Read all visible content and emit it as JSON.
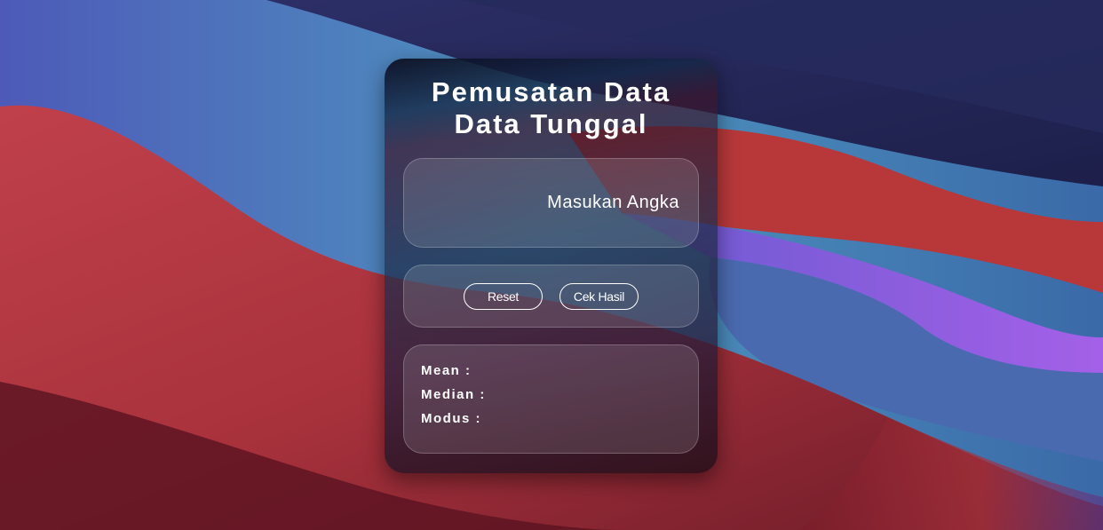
{
  "colors": {
    "wallpaper_red": "#b83a3a",
    "wallpaper_purple": "#9b5bd8",
    "wallpaper_navy": "#242755",
    "wallpaper_blue": "#4f8fc0",
    "text": "#ffffff"
  },
  "card": {
    "title_line1": "Pemusatan Data",
    "title_line2": "Data Tunggal"
  },
  "input": {
    "placeholder": "Masukan Angka",
    "value": ""
  },
  "buttons": {
    "reset_label": "Reset",
    "cek_hasil_label": "Cek Hasil"
  },
  "results": {
    "mean_label": "Mean :",
    "mean_value": "",
    "median_label": "Median :",
    "median_value": "",
    "modus_label": "Modus :",
    "modus_value": ""
  }
}
